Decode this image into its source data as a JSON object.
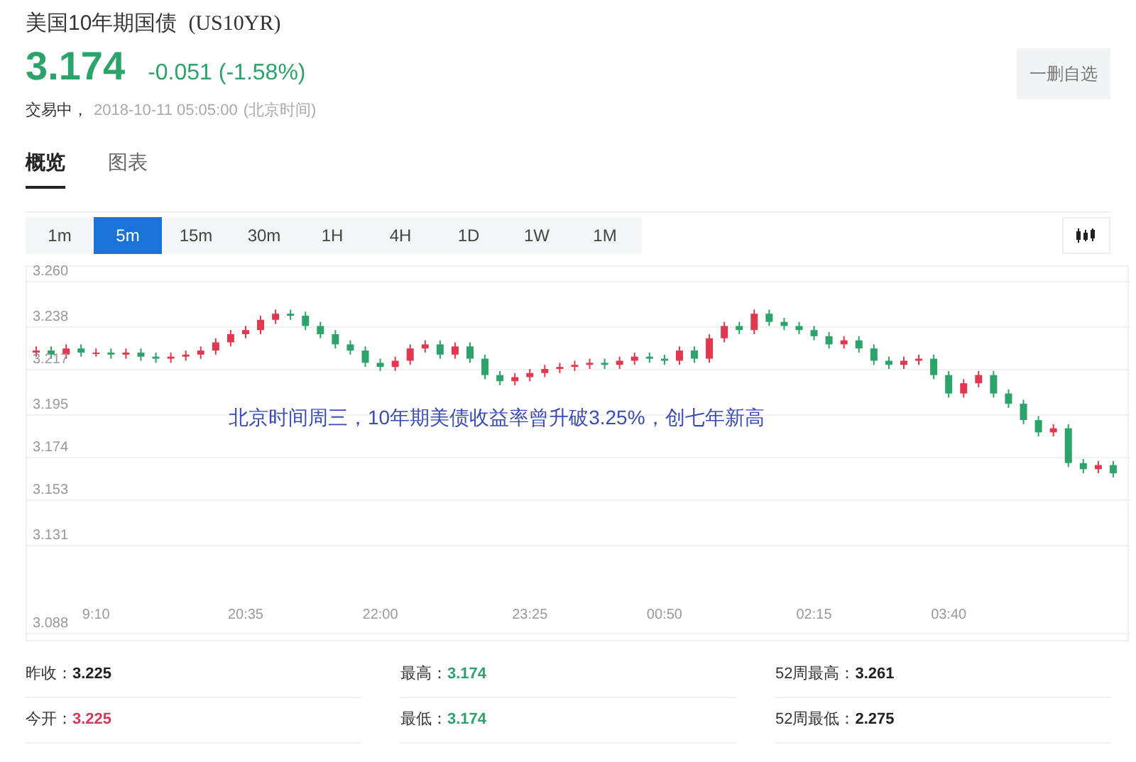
{
  "header": {
    "title": "美国10年期国债",
    "symbol": "(US10YR)",
    "price": "3.174",
    "change": "-0.051 (-1.58%)",
    "status": "交易中，",
    "time": "2018-10-11 05:05:00",
    "timezone": "(北京时间)",
    "watch_button": "一删自选"
  },
  "tabs": [
    {
      "label": "概览",
      "selected": true
    },
    {
      "label": "图表",
      "selected": false
    }
  ],
  "intervals": [
    {
      "label": "1m",
      "selected": false
    },
    {
      "label": "5m",
      "selected": true
    },
    {
      "label": "15m",
      "selected": false
    },
    {
      "label": "30m",
      "selected": false
    },
    {
      "label": "1H",
      "selected": false
    },
    {
      "label": "4H",
      "selected": false
    },
    {
      "label": "1D",
      "selected": false
    },
    {
      "label": "1W",
      "selected": false
    },
    {
      "label": "1M",
      "selected": false
    }
  ],
  "chart": {
    "chart_data": {
      "type": "candlestick",
      "categories": [
        null,
        null,
        null,
        null,
        "9:10",
        null,
        null,
        null,
        null,
        null,
        null,
        null,
        null,
        null,
        "20:35",
        null,
        null,
        null,
        null,
        null,
        null,
        null,
        null,
        "22:00",
        null,
        null,
        null,
        null,
        null,
        null,
        null,
        null,
        null,
        "23:25",
        null,
        null,
        null,
        null,
        null,
        null,
        null,
        null,
        "00:50",
        null,
        null,
        null,
        null,
        null,
        null,
        null,
        null,
        null,
        "02:15",
        null,
        null,
        null,
        null,
        null,
        null,
        null,
        null,
        "03:40",
        null,
        null,
        null,
        null,
        null,
        null,
        null,
        null,
        null,
        null,
        null
      ],
      "ohlc": [
        [
          3.225,
          3.228,
          3.223,
          3.226
        ],
        [
          3.226,
          3.228,
          3.222,
          3.224
        ],
        [
          3.224,
          3.229,
          3.222,
          3.227
        ],
        [
          3.227,
          3.229,
          3.223,
          3.225
        ],
        [
          3.225,
          3.227,
          3.223,
          3.225
        ],
        [
          3.225,
          3.227,
          3.222,
          3.224
        ],
        [
          3.224,
          3.227,
          3.222,
          3.225
        ],
        [
          3.225,
          3.227,
          3.221,
          3.223
        ],
        [
          3.223,
          3.225,
          3.22,
          3.222
        ],
        [
          3.222,
          3.225,
          3.22,
          3.223
        ],
        [
          3.223,
          3.226,
          3.221,
          3.224
        ],
        [
          3.224,
          3.228,
          3.222,
          3.226
        ],
        [
          3.226,
          3.232,
          3.224,
          3.23
        ],
        [
          3.23,
          3.236,
          3.228,
          3.234
        ],
        [
          3.234,
          3.238,
          3.232,
          3.236
        ],
        [
          3.236,
          3.243,
          3.234,
          3.241
        ],
        [
          3.241,
          3.246,
          3.239,
          3.244
        ],
        [
          3.244,
          3.246,
          3.241,
          3.243
        ],
        [
          3.243,
          3.245,
          3.236,
          3.238
        ],
        [
          3.238,
          3.24,
          3.232,
          3.234
        ],
        [
          3.234,
          3.236,
          3.227,
          3.229
        ],
        [
          3.229,
          3.231,
          3.224,
          3.226
        ],
        [
          3.226,
          3.228,
          3.218,
          3.22
        ],
        [
          3.22,
          3.222,
          3.216,
          3.218
        ],
        [
          3.218,
          3.223,
          3.216,
          3.221
        ],
        [
          3.221,
          3.229,
          3.219,
          3.227
        ],
        [
          3.227,
          3.231,
          3.225,
          3.229
        ],
        [
          3.229,
          3.231,
          3.222,
          3.224
        ],
        [
          3.224,
          3.23,
          3.222,
          3.228
        ],
        [
          3.228,
          3.23,
          3.22,
          3.222
        ],
        [
          3.222,
          3.224,
          3.212,
          3.214
        ],
        [
          3.214,
          3.216,
          3.209,
          3.211
        ],
        [
          3.211,
          3.215,
          3.209,
          3.213
        ],
        [
          3.213,
          3.217,
          3.211,
          3.215
        ],
        [
          3.215,
          3.219,
          3.213,
          3.217
        ],
        [
          3.217,
          3.22,
          3.215,
          3.218
        ],
        [
          3.218,
          3.221,
          3.216,
          3.219
        ],
        [
          3.219,
          3.222,
          3.217,
          3.22
        ],
        [
          3.22,
          3.222,
          3.217,
          3.219
        ],
        [
          3.219,
          3.223,
          3.217,
          3.221
        ],
        [
          3.221,
          3.225,
          3.219,
          3.223
        ],
        [
          3.223,
          3.225,
          3.22,
          3.222
        ],
        [
          3.222,
          3.224,
          3.219,
          3.221
        ],
        [
          3.221,
          3.228,
          3.219,
          3.226
        ],
        [
          3.226,
          3.228,
          3.22,
          3.222
        ],
        [
          3.222,
          3.234,
          3.22,
          3.232
        ],
        [
          3.232,
          3.24,
          3.23,
          3.238
        ],
        [
          3.238,
          3.24,
          3.234,
          3.236
        ],
        [
          3.236,
          3.246,
          3.234,
          3.244
        ],
        [
          3.244,
          3.246,
          3.238,
          3.24
        ],
        [
          3.24,
          3.242,
          3.236,
          3.238
        ],
        [
          3.238,
          3.24,
          3.234,
          3.236
        ],
        [
          3.236,
          3.238,
          3.231,
          3.233
        ],
        [
          3.233,
          3.235,
          3.227,
          3.229
        ],
        [
          3.229,
          3.233,
          3.227,
          3.231
        ],
        [
          3.231,
          3.233,
          3.225,
          3.227
        ],
        [
          3.227,
          3.229,
          3.219,
          3.221
        ],
        [
          3.221,
          3.223,
          3.217,
          3.219
        ],
        [
          3.219,
          3.223,
          3.217,
          3.221
        ],
        [
          3.221,
          3.224,
          3.219,
          3.222
        ],
        [
          3.222,
          3.224,
          3.212,
          3.214
        ],
        [
          3.214,
          3.216,
          3.203,
          3.205
        ],
        [
          3.205,
          3.212,
          3.203,
          3.21
        ],
        [
          3.21,
          3.216,
          3.208,
          3.214
        ],
        [
          3.214,
          3.216,
          3.203,
          3.205
        ],
        [
          3.205,
          3.207,
          3.198,
          3.2
        ],
        [
          3.2,
          3.202,
          3.19,
          3.192
        ],
        [
          3.192,
          3.194,
          3.184,
          3.186
        ],
        [
          3.186,
          3.19,
          3.184,
          3.188
        ],
        [
          3.188,
          3.19,
          3.169,
          3.171
        ],
        [
          3.171,
          3.173,
          3.166,
          3.168
        ],
        [
          3.168,
          3.172,
          3.166,
          3.17
        ],
        [
          3.17,
          3.172,
          3.164,
          3.166
        ]
      ],
      "ylim": [
        3.088,
        3.26
      ],
      "grid": true,
      "yticks": [
        {
          "value": 3.26,
          "label": "3.260"
        },
        {
          "value": 3.238,
          "label": "3.238"
        },
        {
          "value": 3.217,
          "label": "3.217"
        },
        {
          "value": 3.195,
          "label": "3.195"
        },
        {
          "value": 3.174,
          "label": "3.174"
        },
        {
          "value": 3.153,
          "label": "3.153"
        },
        {
          "value": 3.131,
          "label": "3.131"
        },
        {
          "value": 3.088,
          "label": "3.088"
        }
      ],
      "annotations": [
        {
          "text": "北京时间周三，10年期美债收益率曾升破3.25%，创七年新高"
        }
      ]
    }
  },
  "stats": [
    {
      "label": "昨收：",
      "value": "3.225",
      "color": "#222222"
    },
    {
      "label": "最高：",
      "value": "3.174",
      "color": "#2ca36b"
    },
    {
      "label": "52周最高：",
      "value": "3.261",
      "color": "#222222"
    },
    {
      "label": "今开：",
      "value": "3.225",
      "color": "#d8365a"
    },
    {
      "label": "最低：",
      "value": "3.174",
      "color": "#2ca36b"
    },
    {
      "label": "52周最低：",
      "value": "2.275",
      "color": "#222222"
    }
  ]
}
